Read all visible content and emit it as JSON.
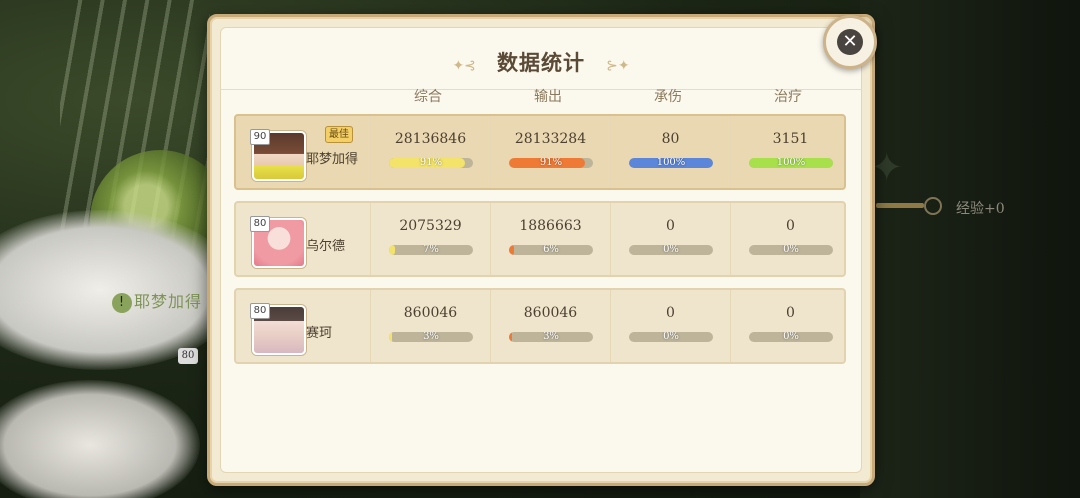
{
  "panel": {
    "title": "数据统计"
  },
  "close": {
    "icon": "close-icon"
  },
  "columns": [
    "综合",
    "输出",
    "承伤",
    "治疗"
  ],
  "colors": {
    "综合": "#f3e36a",
    "输出": "#ef7a36",
    "承伤": "#5b86d9",
    "治疗": "#a7e04a"
  },
  "best_label": "最佳",
  "background": {
    "hint_name": "耶梦加得",
    "exp_text": "经验+0",
    "level": "80"
  },
  "rows": [
    {
      "name": "耶梦加得",
      "level": "90",
      "best": true,
      "stats": [
        {
          "value": "28136846",
          "pct": "91%",
          "fill": 0.91
        },
        {
          "value": "28133284",
          "pct": "91%",
          "fill": 0.91
        },
        {
          "value": "80",
          "pct": "100%",
          "fill": 1.0
        },
        {
          "value": "3151",
          "pct": "100%",
          "fill": 1.0
        }
      ]
    },
    {
      "name": "乌尔德",
      "level": "80",
      "best": false,
      "stats": [
        {
          "value": "2075329",
          "pct": "7%",
          "fill": 0.07
        },
        {
          "value": "1886663",
          "pct": "6%",
          "fill": 0.06
        },
        {
          "value": "0",
          "pct": "0%",
          "fill": 0
        },
        {
          "value": "0",
          "pct": "0%",
          "fill": 0
        }
      ]
    },
    {
      "name": "赛珂",
      "level": "80",
      "best": false,
      "stats": [
        {
          "value": "860046",
          "pct": "3%",
          "fill": 0.03
        },
        {
          "value": "860046",
          "pct": "3%",
          "fill": 0.03
        },
        {
          "value": "0",
          "pct": "0%",
          "fill": 0
        },
        {
          "value": "0",
          "pct": "0%",
          "fill": 0
        }
      ]
    }
  ]
}
